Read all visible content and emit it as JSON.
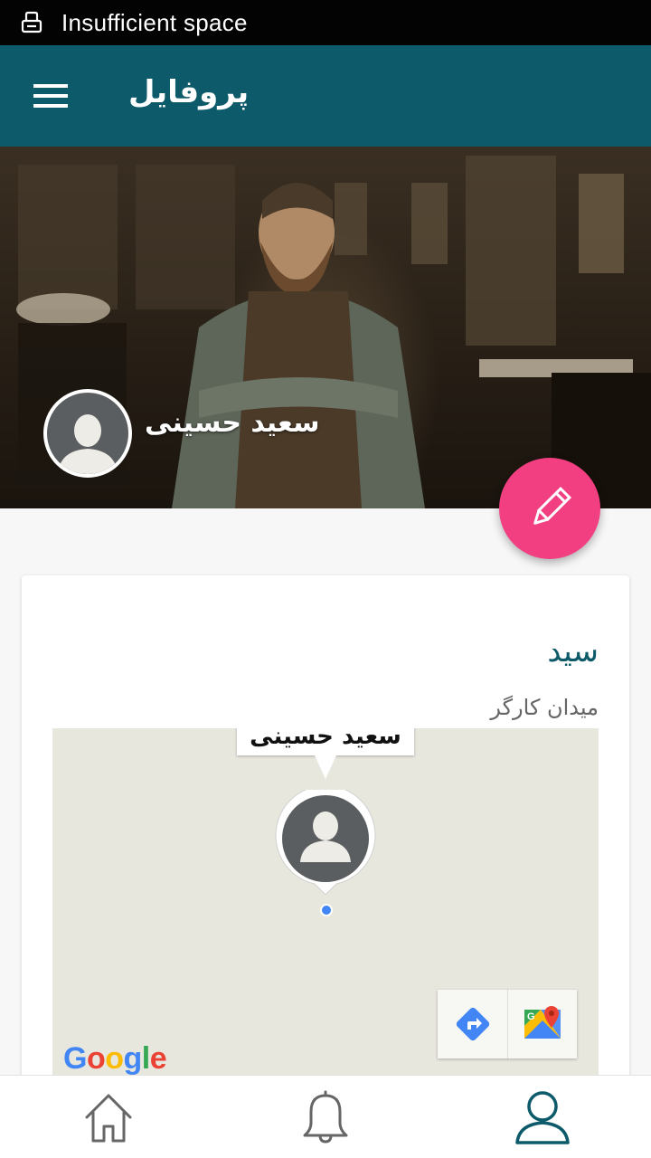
{
  "status_bar": {
    "text": "Insufficient space",
    "icon": "storage-warning-icon"
  },
  "toolbar": {
    "title": "پروفایل",
    "menu_icon": "hamburger-menu-icon"
  },
  "profile": {
    "name": "سعید حسینی",
    "avatar_icon": "default-user-avatar"
  },
  "fab": {
    "icon": "pencil-edit-icon",
    "color": "#f23f82"
  },
  "card": {
    "title": "سید",
    "subtitle": "میدان کارگر"
  },
  "map": {
    "info_window_text": "سعید حسینی",
    "logo": {
      "letters": [
        "G",
        "o",
        "o",
        "g",
        "l",
        "e"
      ],
      "colors": [
        "#4285f4",
        "#ea4335",
        "#fbbc05",
        "#4285f4",
        "#34a853",
        "#ea4335"
      ]
    },
    "buttons": [
      "directions-icon",
      "google-maps-icon"
    ]
  },
  "bottom_nav": {
    "items": [
      "home-icon",
      "bell-icon",
      "person-icon"
    ],
    "active": "person-icon"
  },
  "colors": {
    "primary": "#0c5a6a",
    "accent": "#f23f82"
  }
}
